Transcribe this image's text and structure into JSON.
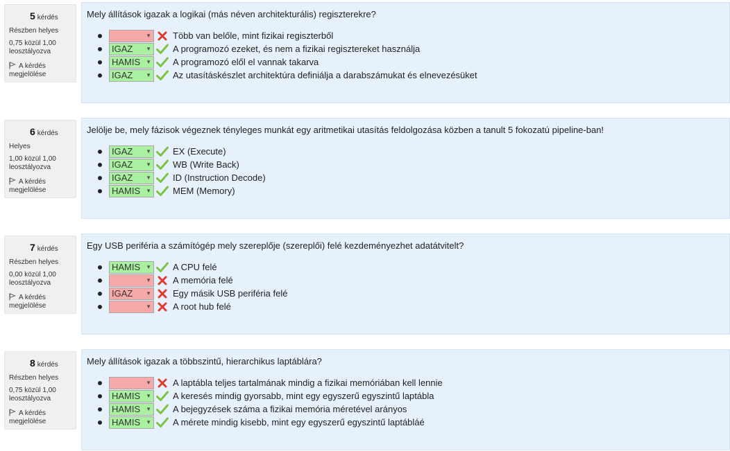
{
  "labels": {
    "question_word": "kérdés",
    "flag_line1": "A kérdés",
    "flag_line2": "megjelölése"
  },
  "questions": [
    {
      "number": "5",
      "state": "Részben helyes",
      "grade_line1": "0,75 közül 1,00",
      "grade_line2": "leosztályozva",
      "text": "Mely állítások igazak a logikai (más néven architekturális) regiszterekre?",
      "answers": [
        {
          "selected": "",
          "result": "wrong",
          "text": "Több van belőle, mint fizikai regiszterből"
        },
        {
          "selected": "IGAZ",
          "result": "correct",
          "text": "A programozó ezeket, és nem a fizikai regisztereket használja"
        },
        {
          "selected": "HAMIS",
          "result": "correct",
          "text": "A programozó elől el vannak takarva"
        },
        {
          "selected": "IGAZ",
          "result": "correct",
          "text": "Az utasításkészlet architektúra definiálja a darabszámukat és elnevezésüket"
        }
      ]
    },
    {
      "number": "6",
      "state": "Helyes",
      "grade_line1": "1,00 közül 1,00",
      "grade_line2": "leosztályozva",
      "text": "Jelölje be, mely fázisok végeznek tényleges munkát egy aritmetikai utasítás feldolgozása közben a tanult 5 fokozatú pipeline-ban!",
      "answers": [
        {
          "selected": "IGAZ",
          "result": "correct",
          "text": "EX (Execute)"
        },
        {
          "selected": "IGAZ",
          "result": "correct",
          "text": "WB (Write Back)"
        },
        {
          "selected": "IGAZ",
          "result": "correct",
          "text": "ID (Instruction Decode)"
        },
        {
          "selected": "HAMIS",
          "result": "correct",
          "text": "MEM (Memory)"
        }
      ]
    },
    {
      "number": "7",
      "state": "Részben helyes",
      "grade_line1": "0,00 közül 1,00",
      "grade_line2": "leosztályozva",
      "text": "Egy USB periféria a számítógép mely szereplője (szereplői) felé kezdeményezhet adatátvitelt?",
      "answers": [
        {
          "selected": "HAMIS",
          "result": "correct",
          "text": "A CPU felé"
        },
        {
          "selected": "",
          "result": "wrong",
          "text": "A memória felé"
        },
        {
          "selected": "IGAZ",
          "result": "wrong",
          "text": "Egy másik USB periféria felé"
        },
        {
          "selected": "",
          "result": "wrong",
          "text": "A root hub felé"
        }
      ]
    },
    {
      "number": "8",
      "state": "Részben helyes",
      "grade_line1": "0,75 közül 1,00",
      "grade_line2": "leosztályozva",
      "text": "Mely állítások igazak a többszintű, hierarchikus laptáblára?",
      "answers": [
        {
          "selected": "",
          "result": "wrong",
          "text": "A laptábla teljes tartalmának mindig a fizikai memóriában kell lennie"
        },
        {
          "selected": "HAMIS",
          "result": "correct",
          "text": "A keresés mindig gyorsabb, mint egy egyszerű egyszintű laptábla"
        },
        {
          "selected": "HAMIS",
          "result": "correct",
          "text": "A bejegyzések száma a fizikai memória méretével arányos"
        },
        {
          "selected": "HAMIS",
          "result": "correct",
          "text": "A mérete mindig kisebb, mint egy egyszerű egyszintű laptábláé"
        }
      ]
    }
  ],
  "icons": {
    "correct": "check-icon",
    "wrong": "cross-icon",
    "flag": "flag-icon",
    "dropdown": "chevron-down-icon"
  },
  "colors": {
    "correct_bg": "#a9f0a0",
    "wrong_bg": "#f7a9a9",
    "check": "#7cc243",
    "cross": "#e03a2f",
    "content_bg": "#e6f1fb",
    "info_bg": "#f0f0f0"
  }
}
